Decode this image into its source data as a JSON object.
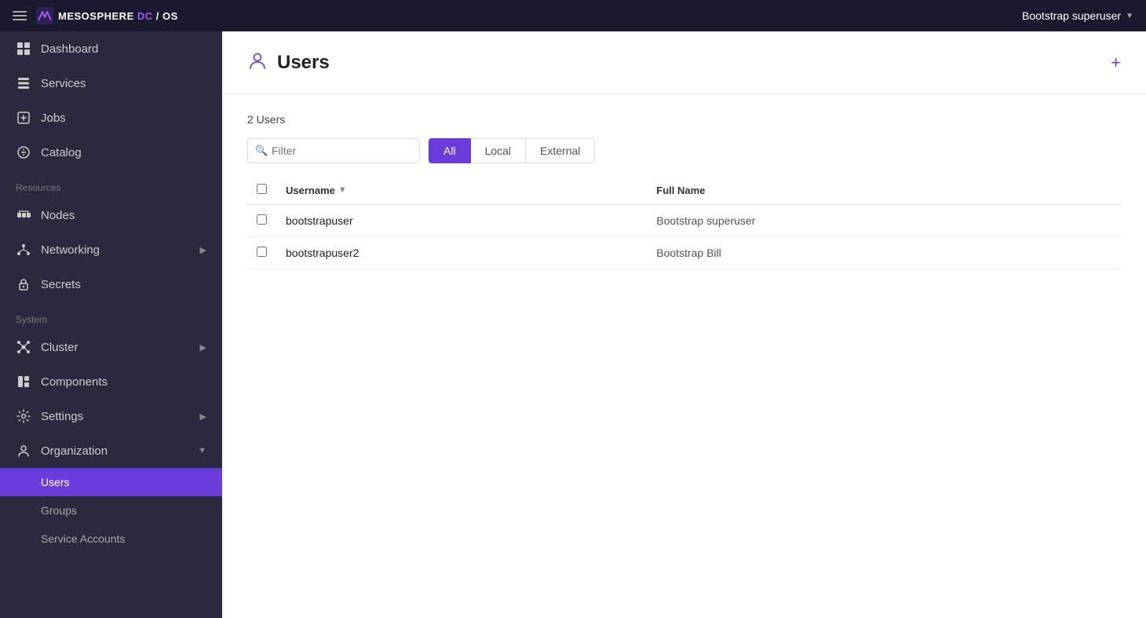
{
  "topbar": {
    "logo_text_meso": "MESOSPHERE",
    "logo_dc": "DC",
    "logo_slash": "/",
    "logo_os": "OS",
    "user_label": "Bootstrap superuser"
  },
  "sidebar": {
    "nav_items": [
      {
        "id": "dashboard",
        "label": "Dashboard",
        "icon": "dashboard-icon",
        "has_arrow": false
      },
      {
        "id": "services",
        "label": "Services",
        "icon": "services-icon",
        "has_arrow": false
      },
      {
        "id": "jobs",
        "label": "Jobs",
        "icon": "jobs-icon",
        "has_arrow": false
      },
      {
        "id": "catalog",
        "label": "Catalog",
        "icon": "catalog-icon",
        "has_arrow": false
      }
    ],
    "resources_label": "Resources",
    "resources_items": [
      {
        "id": "nodes",
        "label": "Nodes",
        "icon": "nodes-icon",
        "has_arrow": false
      },
      {
        "id": "networking",
        "label": "Networking",
        "icon": "networking-icon",
        "has_arrow": true
      },
      {
        "id": "secrets",
        "label": "Secrets",
        "icon": "secrets-icon",
        "has_arrow": false
      }
    ],
    "system_label": "System",
    "system_items": [
      {
        "id": "cluster",
        "label": "Cluster",
        "icon": "cluster-icon",
        "has_arrow": true
      },
      {
        "id": "components",
        "label": "Components",
        "icon": "components-icon",
        "has_arrow": false
      },
      {
        "id": "settings",
        "label": "Settings",
        "icon": "settings-icon",
        "has_arrow": true
      },
      {
        "id": "organization",
        "label": "Organization",
        "icon": "organization-icon",
        "has_arrow_down": true
      }
    ],
    "org_sub_items": [
      {
        "id": "users",
        "label": "Users",
        "active": true
      },
      {
        "id": "groups",
        "label": "Groups",
        "active": false
      },
      {
        "id": "service-accounts",
        "label": "Service Accounts",
        "active": false
      }
    ]
  },
  "page": {
    "title": "Users",
    "users_count": "2 Users",
    "add_btn_label": "+",
    "filter_placeholder": "Filter",
    "tabs": [
      {
        "id": "all",
        "label": "All",
        "active": true
      },
      {
        "id": "local",
        "label": "Local",
        "active": false
      },
      {
        "id": "external",
        "label": "External",
        "active": false
      }
    ],
    "table": {
      "col_username": "Username",
      "col_fullname": "Full Name",
      "rows": [
        {
          "username": "bootstrapuser",
          "fullname": "Bootstrap superuser"
        },
        {
          "username": "bootstrapuser2",
          "fullname": "Bootstrap Bill"
        }
      ]
    }
  }
}
